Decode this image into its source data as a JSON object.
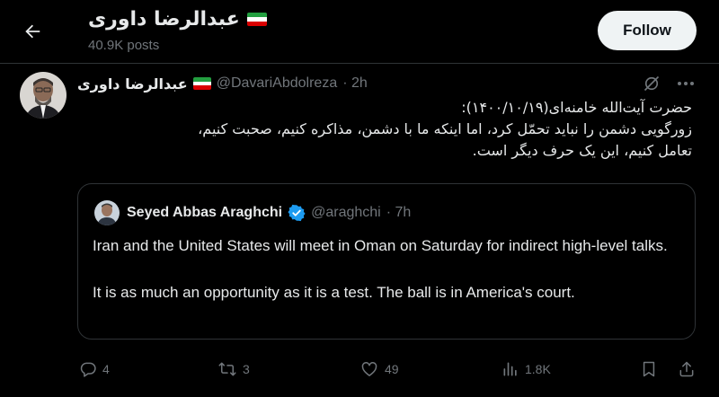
{
  "header": {
    "title": "عبدالرضا داوری",
    "posts": "40.9K posts",
    "follow_label": "Follow"
  },
  "post": {
    "author_name": "عبدالرضا داوری",
    "handle": "@DavariAbdolreza",
    "time": "· 2h",
    "body_lines": [
      "حضرت آیت‌الله خامنه‌ای(۱۴۰۰/۱۰/۱۹):",
      "زورگویی دشمن را نباید تحمّل کرد، اما اینکه ما با دشمن، مذاکره کنیم، صحبت کنیم،",
      "تعامل کنیم، این یک حرف دیگر است."
    ]
  },
  "quote": {
    "name": "Seyed Abbas Araghchi",
    "handle": "@araghchi",
    "time": "· 7h",
    "paragraph1": "Iran and the United States will meet in Oman on Saturday for indirect high-level talks.",
    "paragraph2": "It is as much an opportunity as it is a test. The ball is in America's court."
  },
  "actions": {
    "replies": "4",
    "reposts": "3",
    "likes": "49",
    "views": "1.8K"
  },
  "icons": [
    "back-arrow-icon",
    "iran-flag-icon",
    "grok-icon",
    "more-icon",
    "verified-badge-icon",
    "reply-icon",
    "repost-icon",
    "like-icon",
    "views-icon",
    "bookmark-icon",
    "share-icon"
  ],
  "colors": {
    "background": "#000000",
    "text": "#e7e9ea",
    "muted": "#71767b",
    "border": "#2f3336",
    "verified": "#1d9bf0",
    "follow_bg": "#eff3f4"
  }
}
